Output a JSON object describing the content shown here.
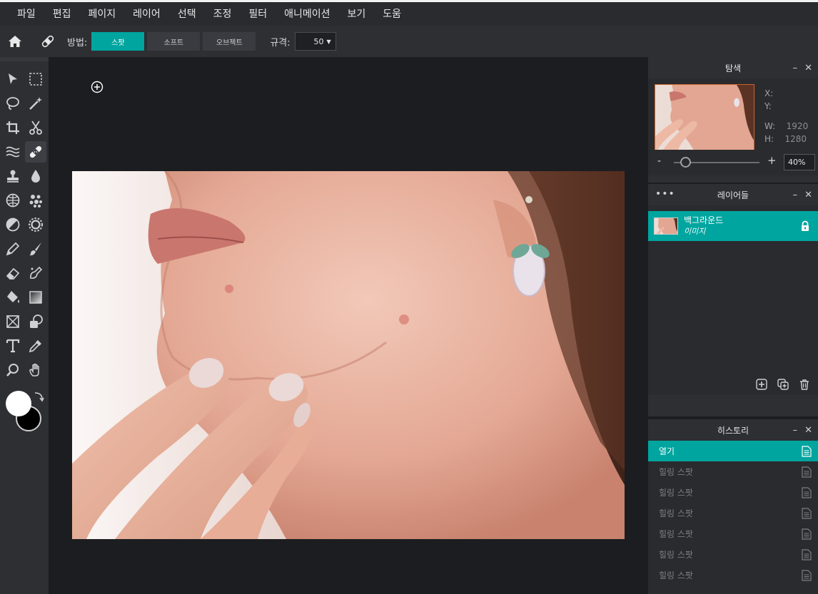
{
  "menu": [
    "파일",
    "편집",
    "페이지",
    "레이어",
    "선택",
    "조정",
    "필터",
    "애니메이션",
    "보기",
    "도움"
  ],
  "options": {
    "method_label": "방법:",
    "modes": [
      "스팟",
      "소프트",
      "오브젝트"
    ],
    "active_mode": "스팟",
    "size_label": "규격:",
    "size_value": "50"
  },
  "tools": [
    "move-tool",
    "marquee-tool",
    "lasso-tool",
    "magic-wand-tool",
    "crop-tool",
    "cut-tool",
    "liquify-tool",
    "heal-tool",
    "clone-stamp-tool",
    "blur-tool",
    "sponge-tool",
    "color-replace-tool",
    "dodge-tool",
    "sharpen-tool",
    "pencil-tool",
    "brush-tool",
    "eraser-tool",
    "smudge-tool",
    "paint-bucket-tool",
    "gradient-tool",
    "shape-tool",
    "shape-combine-tool",
    "text-tool",
    "eyedropper-tool",
    "zoom-tool",
    "hand-tool"
  ],
  "active_tool": "heal-tool",
  "colors": {
    "foreground": "#ffffff",
    "background": "#000000",
    "accent": "#00a59f"
  },
  "navigator": {
    "title": "탐색",
    "x_label": "X:",
    "x_value": "",
    "y_label": "Y:",
    "y_value": "",
    "w_label": "W:",
    "w_value": "1920",
    "h_label": "H:",
    "h_value": "1280",
    "zoom_minus": "-",
    "zoom_plus": "+",
    "zoom_value": "40%",
    "zoom_level": 0.4
  },
  "layers": {
    "title": "레이어들",
    "items": [
      {
        "name": "백그라운드",
        "type": "이미지",
        "locked": true
      }
    ]
  },
  "history": {
    "title": "히스토리",
    "items": [
      "열기",
      "힐링 스팟",
      "힐링 스팟",
      "힐링 스팟",
      "힐링 스팟",
      "힐링 스팟",
      "힐링 스팟"
    ]
  }
}
